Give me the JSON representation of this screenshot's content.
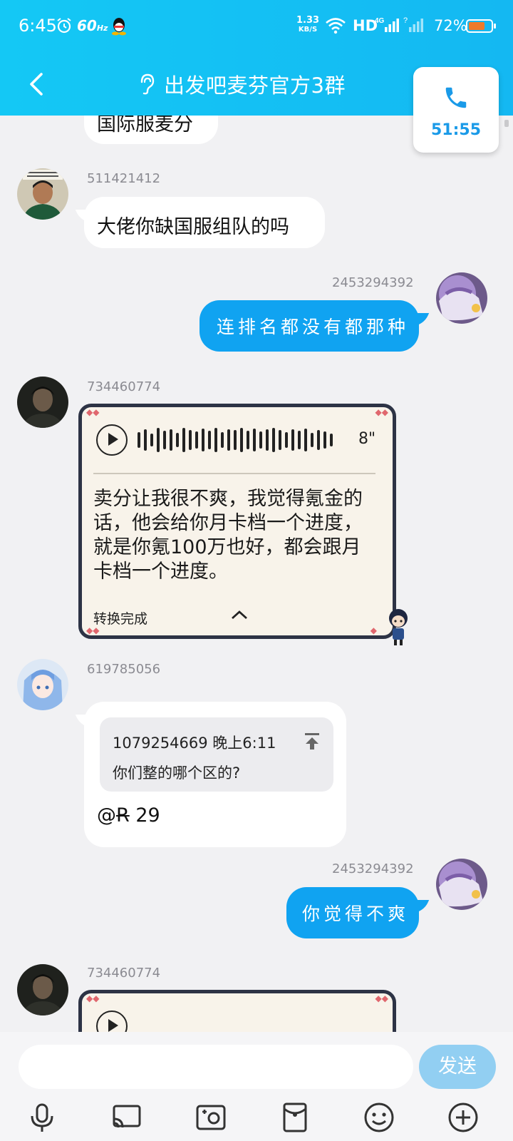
{
  "status_bar": {
    "time": "6:45",
    "refresh_rate": "60",
    "refresh_unit": "Hz",
    "net_speed_value": "1.33",
    "net_speed_unit": "KB/S",
    "hd_label": "HD",
    "network_type": "4G",
    "battery_percent": "72%",
    "battery_level": 0.72,
    "battery_color": "#ee7a2a"
  },
  "header": {
    "title": "出发吧麦芬官方3群",
    "call_timer": "51:55",
    "background_color": "#14c8f5"
  },
  "messages": [
    {
      "type": "text_partial",
      "direction": "incoming",
      "text": "国际服麦分"
    },
    {
      "type": "text",
      "direction": "incoming",
      "sender": "511421412",
      "avatar": "avatar-man-green-shirt",
      "text": "大佬你缺国服组队的吗"
    },
    {
      "type": "text",
      "direction": "outgoing",
      "sender": "2453294392",
      "avatar": "avatar-anime-purple",
      "text": "连排名都没有都那种"
    },
    {
      "type": "voice",
      "direction": "incoming",
      "sender": "734460774",
      "avatar": "avatar-dark-portrait",
      "duration": "8\"",
      "transcript": "卖分让我很不爽，我觉得氪金的话，他会给你月卡档一个进度，就是你氪100万也好，都会跟月卡档一个进度。",
      "status": "转换完成"
    },
    {
      "type": "reply",
      "direction": "incoming",
      "sender": "619785056",
      "avatar": "avatar-anime-blue-hair",
      "quote_sender": "1079254669",
      "quote_time": "晚上6:11",
      "quote_text": "你们整的哪个区的?",
      "mention_prefix": "@",
      "mention_name": "R",
      "mention_text": "29"
    },
    {
      "type": "text",
      "direction": "outgoing",
      "sender": "2453294392",
      "avatar": "avatar-anime-purple",
      "text": "你觉得不爽"
    },
    {
      "type": "voice_partial",
      "direction": "incoming",
      "sender": "734460774",
      "avatar": "avatar-dark-portrait"
    }
  ],
  "composer": {
    "input_value": "",
    "send_label": "发送",
    "toolbar_icons": [
      "microphone-icon",
      "screen-share-icon",
      "photo-icon",
      "red-packet-icon",
      "emoji-icon",
      "add-icon"
    ]
  },
  "colors": {
    "outgoing_bubble": "#10a3f1",
    "send_button": "#92cff2",
    "accent_blue": "#1a9ae8"
  }
}
